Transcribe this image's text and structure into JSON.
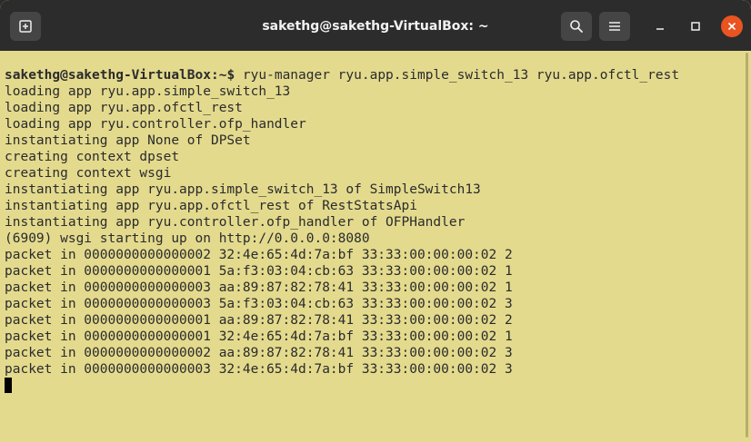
{
  "window": {
    "title": "sakethg@sakethg-VirtualBox: ~"
  },
  "titlebar": {
    "new_tab_icon": "new-tab-icon",
    "search_icon": "search-icon",
    "menu_icon": "hamburger-menu-icon",
    "minimize_icon": "minimize-icon",
    "maximize_icon": "maximize-icon",
    "close_icon": "close-icon"
  },
  "colors": {
    "terminal_bg": "#e3da8e",
    "titlebar_bg": "#2c2c2c",
    "close_accent": "#e95420"
  },
  "terminal": {
    "prompt": {
      "user_host": "sakethg@sakethg-VirtualBox",
      "path": ":~$",
      "command": " ryu-manager ryu.app.simple_switch_13 ryu.app.ofctl_rest"
    },
    "lines": [
      "loading app ryu.app.simple_switch_13",
      "loading app ryu.app.ofctl_rest",
      "loading app ryu.controller.ofp_handler",
      "instantiating app None of DPSet",
      "creating context dpset",
      "creating context wsgi",
      "instantiating app ryu.app.simple_switch_13 of SimpleSwitch13",
      "instantiating app ryu.app.ofctl_rest of RestStatsApi",
      "instantiating app ryu.controller.ofp_handler of OFPHandler",
      "(6909) wsgi starting up on http://0.0.0.0:8080",
      "packet in 0000000000000002 32:4e:65:4d:7a:bf 33:33:00:00:00:02 2",
      "packet in 0000000000000001 5a:f3:03:04:cb:63 33:33:00:00:00:02 1",
      "packet in 0000000000000003 aa:89:87:82:78:41 33:33:00:00:00:02 1",
      "packet in 0000000000000003 5a:f3:03:04:cb:63 33:33:00:00:00:02 3",
      "packet in 0000000000000001 aa:89:87:82:78:41 33:33:00:00:00:02 2",
      "packet in 0000000000000001 32:4e:65:4d:7a:bf 33:33:00:00:00:02 1",
      "packet in 0000000000000002 aa:89:87:82:78:41 33:33:00:00:00:02 3",
      "packet in 0000000000000003 32:4e:65:4d:7a:bf 33:33:00:00:00:02 3"
    ]
  }
}
